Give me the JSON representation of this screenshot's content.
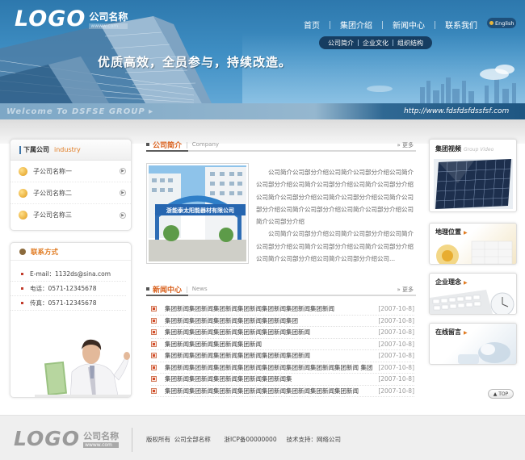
{
  "header": {
    "logo_word": "LOGO",
    "company_name": "公司名称",
    "logo_url": "wwww.com",
    "nav": [
      "首页",
      "集团介绍",
      "新闻中心",
      "联系我们"
    ],
    "lang_label": "English",
    "subnav": [
      "公司简介",
      "企业文化",
      "组织结构"
    ],
    "slogan": "优质高效，全员参与，持续改造。",
    "welcome": "Welcome To DSFSE GROUP ▸",
    "site_url": "http://www.fdsfdsfdssfsf.com"
  },
  "subsidiaries": {
    "title": "下属公司",
    "title_en": "industry",
    "items": [
      "子公司名称一",
      "子公司名称二",
      "子公司名称三"
    ]
  },
  "contact": {
    "title": "联系方式",
    "rows": [
      "E-mail：1132ds@sina.com",
      "电话：0571-12345678",
      "传真：0571-12345678"
    ]
  },
  "intro": {
    "title": "公司简介",
    "title_en": "Company",
    "more": "更多",
    "photo_sign": "浙能泰太阳能器材有限公司",
    "paragraphs": [
      "公司简介公司部分介绍公司简介公司部分介绍公司简介公司部分介绍公司简介公司部分介绍公司简介公司部分介绍公司简介公司部分介绍公司简介公司部分介绍公司简介公司部分介绍公司简介公司部分介绍公司简介公司部分介绍公司简介公司部分介绍",
      "公司简介公司部分介绍公司简介公司部分介绍公司简介公司部分介绍公司简介公司部分介绍公司简介公司部分介绍公司简介公司部分介绍公司简介公司部分介绍公司..."
    ]
  },
  "news": {
    "title": "新闻中心",
    "title_en": "News",
    "more": "更多",
    "items": [
      {
        "title": "集团新闻集团新闻集团新闻集团新闻集团新闻集团新闻集团新闻",
        "date": "[2007-10-8]"
      },
      {
        "title": "集团新闻集团新闻集团新闻集团新闻集团新闻集团",
        "date": "[2007-10-8]"
      },
      {
        "title": "集团新闻集团新闻集团新闻集团新闻集团新闻集团新闻",
        "date": "[2007-10-8]"
      },
      {
        "title": "集团新闻集团新闻集团新闻集团新闻",
        "date": "[2007-10-8]"
      },
      {
        "title": "集团新闻集团新闻集团新闻集团新闻集团新闻集团新闻",
        "date": "[2007-10-8]"
      },
      {
        "title": "集团新闻集团新闻集团新闻集团新闻集团新闻集团新闻集团新闻集团新闻 集团",
        "date": "[2007-10-8]"
      },
      {
        "title": "集团新闻集团新闻集团新闻集团新闻集团新闻集",
        "date": "[2007-10-8]"
      },
      {
        "title": "集团新闻集团新闻集团新闻集团新闻集团新闻集团新闻集团新闻集团新闻",
        "date": "[2007-10-8]"
      }
    ]
  },
  "right": {
    "video_title": "集团视频",
    "video_en": "Group Video",
    "location": "地理位置",
    "culture": "企业理念",
    "message": "在线留言",
    "top": "TOP"
  },
  "footer": {
    "logo_word": "LOGO",
    "company_name": "公司名称",
    "logo_url": "wwww.com",
    "copyright": "版权所有  公司全部名称       浙ICP备00000000     技术支持：网络公司"
  },
  "colors": {
    "accent": "#e07a20",
    "brand_blue": "#2d78ad",
    "nav_dark": "#163d61"
  }
}
